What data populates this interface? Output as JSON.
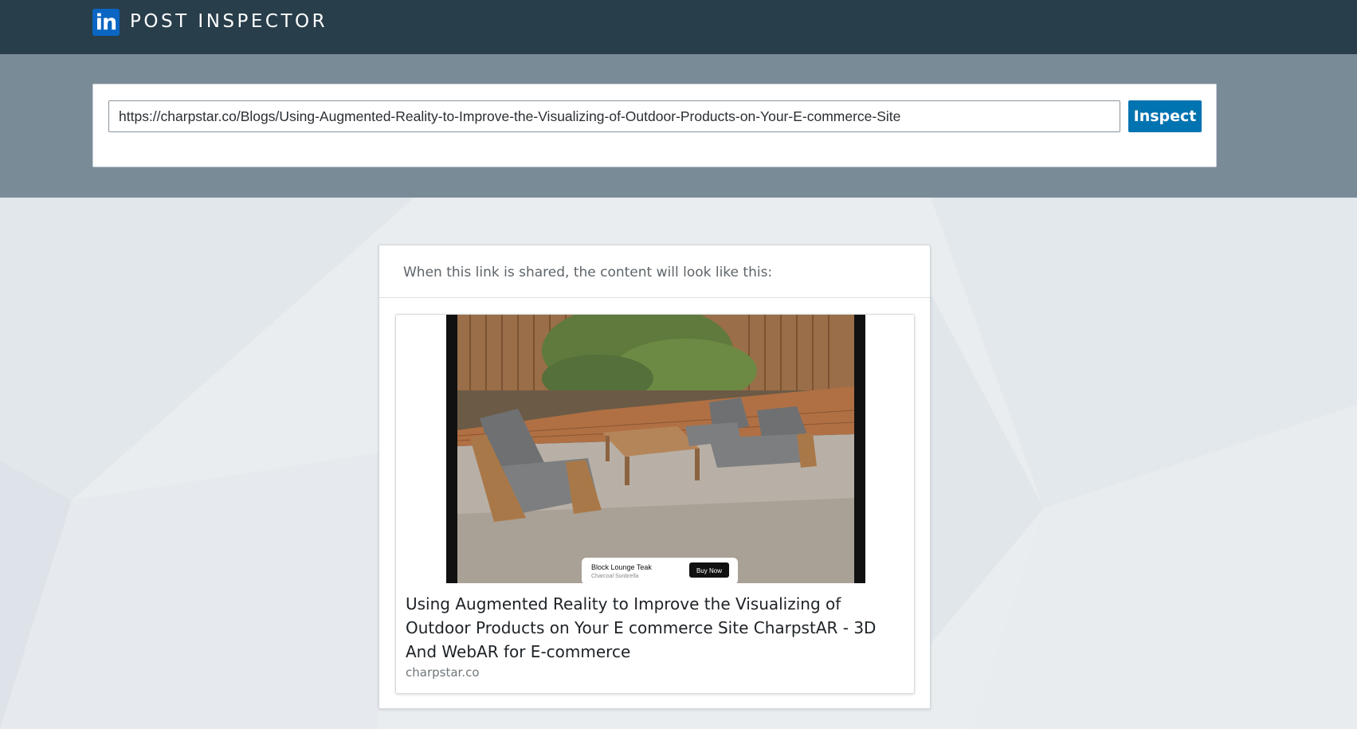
{
  "header": {
    "logo_text": "in",
    "title": "POST INSPECTOR"
  },
  "inspect": {
    "url_value": "https://charpstar.co/Blogs/Using-Augmented-Reality-to-Improve-the-Visualizing-of-Outdoor-Products-on-Your-E-commerce-Site",
    "button_label": "Inspect"
  },
  "preview": {
    "note": "When this link is shared, the content will look like this:",
    "card": {
      "image_overlay_product": "Block Lounge Teak",
      "image_overlay_variant": "Charcoal Sunbrella",
      "image_overlay_button": "Buy Now",
      "title": "Using Augmented Reality to Improve the Visualizing of Outdoor Products on Your E commerce Site CharpstAR - 3D And WebAR for E-commerce",
      "domain": "charpstar.co"
    }
  },
  "colors": {
    "header_bg": "#283e4a",
    "band_bg": "#7a8b98",
    "accent": "#0073b1",
    "logo_blue": "#0a66c2",
    "page_bg": "#e9edf0"
  },
  "icons": {
    "logo": "linkedin-logo-icon"
  }
}
